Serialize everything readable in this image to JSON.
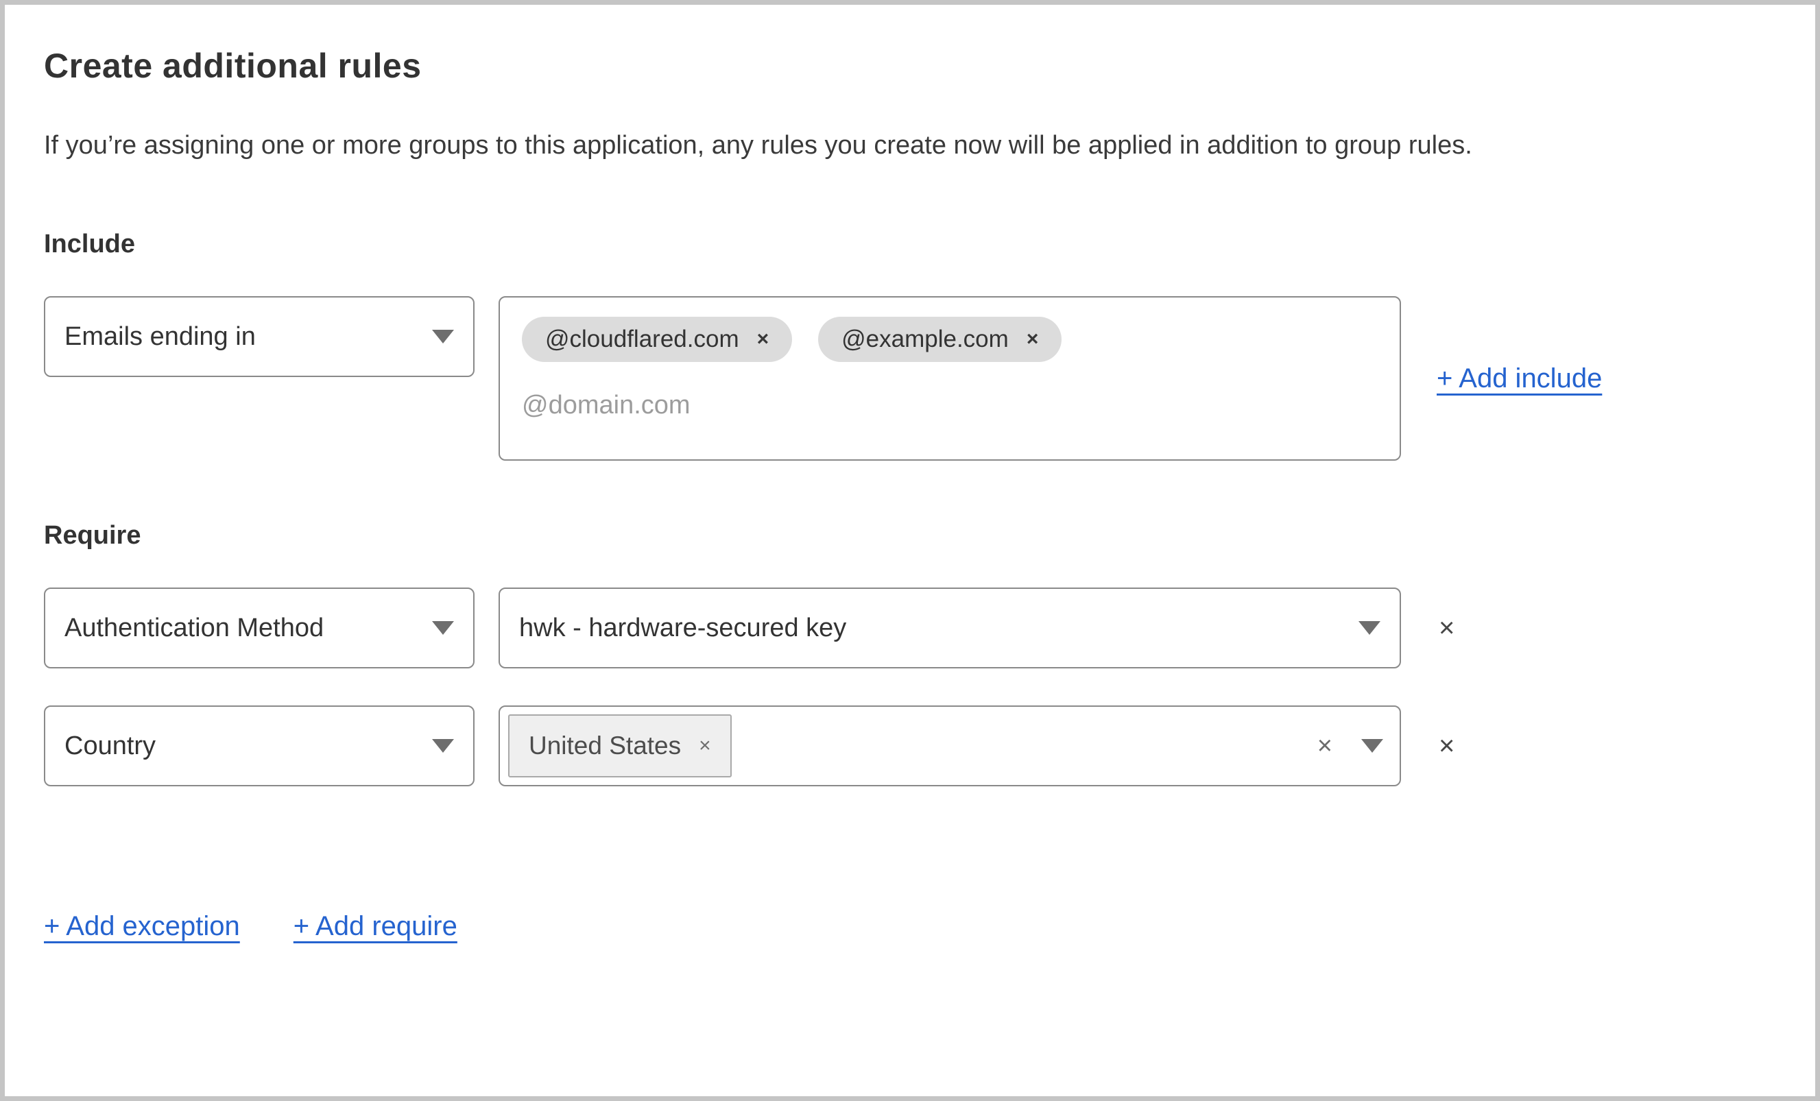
{
  "title": "Create additional rules",
  "description": "If you’re assigning one or more groups to this application, any rules you create now will be applied in addition to group rules.",
  "include": {
    "heading": "Include",
    "selector_value": "Emails ending in",
    "tags": [
      {
        "label": "@cloudflared.com"
      },
      {
        "label": "@example.com"
      }
    ],
    "placeholder": "@domain.com",
    "add_link_label": "+ Add include"
  },
  "require": {
    "heading": "Require",
    "rule1": {
      "selector_value": "Authentication Method",
      "value": "hwk - hardware-secured key"
    },
    "rule2": {
      "selector_value": "Country",
      "tags": [
        {
          "label": "United States"
        }
      ]
    }
  },
  "footer": {
    "add_exception_label": "+ Add exception",
    "add_require_label": "+ Add require"
  },
  "icons": {
    "remove_tag": "×",
    "remove_rule": "×",
    "clear": "×"
  },
  "colors": {
    "link_blue": "#2563cf",
    "field_border": "#8a8a8a",
    "pill_bg": "#dcdcdc",
    "chip_bg": "#efefef",
    "frame_border": "#c5c5c5"
  }
}
